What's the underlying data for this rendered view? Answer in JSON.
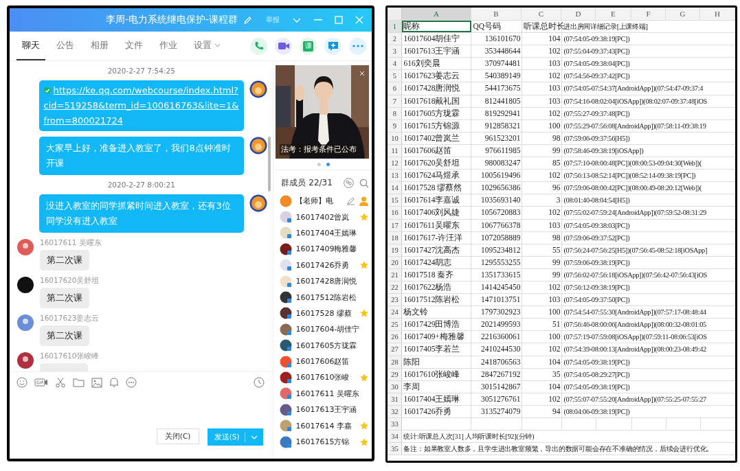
{
  "chat_window": {
    "title": "李周-电力系统继电保护-课程群",
    "report": "举报",
    "tabs": [
      {
        "label": "聊天",
        "selected": true,
        "kind": "plain"
      },
      {
        "label": "公告",
        "selected": false,
        "kind": "plain"
      },
      {
        "label": "相册",
        "selected": false,
        "kind": "plain"
      },
      {
        "label": "文件",
        "selected": false,
        "kind": "plain"
      },
      {
        "label": "作业",
        "selected": false,
        "kind": "plain"
      },
      {
        "label": "设置",
        "selected": false,
        "kind": "menu"
      }
    ],
    "actions": [
      {
        "kind": "call"
      },
      {
        "kind": "video"
      },
      {
        "kind": "course",
        "label": "课"
      },
      {
        "kind": "message"
      },
      {
        "kind": "more"
      }
    ],
    "messages": [
      {
        "kind": "time",
        "text": "2020-2-27 7:54:25"
      },
      {
        "kind": "link",
        "text": "https://ke.qq.com/webcourse/index.html?cid=519258&term_id=100616763&lite=1&from=800021724"
      },
      {
        "kind": "outgoing",
        "text": "大家早上好，准备进入教室了，我们8点钟准时开课"
      },
      {
        "kind": "time",
        "text": "2020-2-27 8:00:21"
      },
      {
        "kind": "outgoing",
        "text": "没进入教室的同学抓紧时间进入教室，还有3位同学没有进入教室"
      },
      {
        "kind": "incoming",
        "sender": "16017611 吴曜东",
        "text": "第二次课"
      },
      {
        "kind": "incoming",
        "sender": "16017620吴舒坦",
        "text": "第二次课"
      },
      {
        "kind": "incoming",
        "sender": "16017623姜志云",
        "text": "第二次课"
      },
      {
        "kind": "incoming",
        "sender": "16017610张峻峰"
      }
    ],
    "buttons": [
      {
        "label": "关闭(C)",
        "kind": "plain"
      },
      {
        "label": "发送(S)",
        "kind": "primary"
      }
    ],
    "ad": {
      "caption": "法考：报考条件已公布",
      "dots": [
        {
          "selected": false
        },
        {
          "selected": true
        }
      ]
    },
    "members_header": "群成员 22/31",
    "members": [
      {
        "name": "【老师】电",
        "kind": "teacher",
        "starred": false
      },
      {
        "name": "16017402曾岚",
        "kind": "student",
        "starred": true
      },
      {
        "name": "16017404王嫣琳",
        "kind": "student",
        "starred": false
      },
      {
        "name": "16017409梅雅馨",
        "kind": "student",
        "starred": false
      },
      {
        "name": "16017426乔勇",
        "kind": "student",
        "starred": true
      },
      {
        "name": "16017428唐润悦",
        "kind": "student",
        "starred": false
      },
      {
        "name": "16017512陈岩松",
        "kind": "student",
        "starred": false
      },
      {
        "name": "16017528 缪蔡",
        "kind": "student",
        "starred": true
      },
      {
        "name": "16017604-胡佳宁",
        "kind": "student",
        "starred": false
      },
      {
        "name": "16017605方珑霖",
        "kind": "student",
        "starred": false
      },
      {
        "name": "16017606赵笛",
        "kind": "student",
        "starred": false
      },
      {
        "name": "16017610张峻",
        "kind": "student",
        "starred": true
      },
      {
        "name": "16017611 吴曜东",
        "kind": "student",
        "starred": false
      },
      {
        "name": "16017613王宇涵",
        "kind": "student",
        "starred": false
      },
      {
        "name": "16017614 李嘉",
        "kind": "student",
        "starred": true
      },
      {
        "name": "16017615方锦",
        "kind": "student",
        "starred": true
      }
    ]
  },
  "spreadsheet": {
    "columns": [
      {
        "label": "A",
        "selected": true
      },
      {
        "label": "B",
        "selected": false
      },
      {
        "label": "C",
        "selected": false
      },
      {
        "label": "D",
        "selected": false
      },
      {
        "label": "E",
        "selected": false
      },
      {
        "label": "F",
        "selected": false
      },
      {
        "label": "G",
        "selected": false
      },
      {
        "label": "H",
        "selected": false
      }
    ],
    "rows": [
      {
        "number": "1",
        "kind": "header",
        "selected": true,
        "cells": [
          "昵称",
          "QQ号码",
          "听课总时长",
          "进出房间详细记录[上课终端]"
        ]
      },
      {
        "number": "2",
        "kind": "data",
        "selected": false,
        "cells": [
          "16017604胡佳宁",
          "136101670",
          "104",
          "(07:54:05-09:38:19[PC])"
        ]
      },
      {
        "number": "3",
        "kind": "data",
        "selected": false,
        "cells": [
          "16017613王宇涵",
          "353448644",
          "102",
          "(07:55:04-09:37:43[PC])"
        ]
      },
      {
        "number": "4",
        "kind": "data",
        "selected": false,
        "cells": [
          "616刘奕晨",
          "370974481",
          "103",
          "(07:54:05-09:38:04[PC])"
        ]
      },
      {
        "number": "5",
        "kind": "data",
        "selected": false,
        "cells": [
          "16017623姜志云",
          "540389149",
          "102",
          "(07:54:56-09:37:42[PC])"
        ]
      },
      {
        "number": "6",
        "kind": "data",
        "selected": false,
        "cells": [
          "16017428唐润悦",
          "544173675",
          "103",
          "(07:54:05-07:54:37[AndroidApp])(07:54:47-09:37:4"
        ]
      },
      {
        "number": "7",
        "kind": "data",
        "selected": false,
        "cells": [
          "16017618戴礼国",
          "812441805",
          "103",
          "(07:54:16-08:02:04[iOSApp])(08:02:07-09:37:48[iOS"
        ]
      },
      {
        "number": "8",
        "kind": "data",
        "selected": false,
        "cells": [
          "16017605方珑霖",
          "819292941",
          "102",
          "(07:55:27-09:37:48[PC])"
        ]
      },
      {
        "number": "9",
        "kind": "data",
        "selected": false,
        "cells": [
          "16017615方锦源",
          "912858321",
          "100",
          "(07:55:29-07:56:08[AndroidApp])(07:58:11-09:38:19"
        ]
      },
      {
        "number": "10",
        "kind": "data",
        "selected": false,
        "cells": [
          "16017402曾岚兰",
          "961523201",
          "98",
          "(07:59:06-09:37:56[H5])"
        ]
      },
      {
        "number": "11",
        "kind": "data",
        "selected": false,
        "cells": [
          "16017606赵笛",
          "976611985",
          "99",
          "(07:58:46-09:38:19[iOSApp])"
        ]
      },
      {
        "number": "12",
        "kind": "data",
        "selected": false,
        "cells": [
          "16017620吴舒坦",
          "980083247",
          "85",
          "(07:57:10-08:00:48[PC])(08:00:53-09:04:30[Web])("
        ]
      },
      {
        "number": "13",
        "kind": "data",
        "selected": false,
        "cells": [
          "16017624马煜承",
          "1005619496",
          "102",
          "(07:56:13-08:52:14[PC])(08:52:14-09:38:19[PC])"
        ]
      },
      {
        "number": "14",
        "kind": "data",
        "selected": false,
        "cells": [
          "16017528 缪蔡然",
          "1029656386",
          "96",
          "(07:59:06-08:00:42[PC])(08:00:49-08:20:12[Web])("
        ]
      },
      {
        "number": "15",
        "kind": "data",
        "selected": false,
        "cells": [
          "16017614李嘉诚",
          "1035693140",
          "3",
          "(08:01:40-08:04:54[H5])"
        ]
      },
      {
        "number": "16",
        "kind": "data",
        "selected": false,
        "cells": [
          "16017406刘风婕",
          "1056720883",
          "102",
          "(07:55:02-07:59:24[AndroidApp])(07:59:52-08:31:29"
        ]
      },
      {
        "number": "17",
        "kind": "data",
        "selected": false,
        "cells": [
          "16017611吴曜东",
          "1067766378",
          "103",
          "(07:54:05-09:38:03[PC])"
        ]
      },
      {
        "number": "18",
        "kind": "data",
        "selected": false,
        "cells": [
          "16017617-许汪洋",
          "1072058889",
          "98",
          "(07:59:06-09:37:52[PC])"
        ]
      },
      {
        "number": "19",
        "kind": "data",
        "selected": false,
        "cells": [
          "16017427沈高杰",
          "1095234812",
          "55",
          "(07:56:24-07:56:25[H5])(07:56:45-08:52:18[iOSApp]"
        ]
      },
      {
        "number": "20",
        "kind": "data",
        "selected": false,
        "cells": [
          "16017424胡志",
          "1295553255",
          "99",
          "(07:59:06-09:38:19[PC])"
        ]
      },
      {
        "number": "21",
        "kind": "data",
        "selected": false,
        "cells": [
          "16017518 秦齐",
          "1351733615",
          "99",
          "(07:56:02-07:56:18[iOSApp])(07:56:42-07:56:43[iOS"
        ]
      },
      {
        "number": "22",
        "kind": "data",
        "selected": false,
        "cells": [
          "16017622杨浩",
          "1414245450",
          "102",
          "(07:56:12-09:38:19[PC])"
        ]
      },
      {
        "number": "23",
        "kind": "data",
        "selected": false,
        "cells": [
          "16017512陈岩松",
          "1471013751",
          "103",
          "(07:54:05-09:37:50[PC])"
        ]
      },
      {
        "number": "24",
        "kind": "data",
        "selected": false,
        "cells": [
          "杨文铃",
          "1797302923",
          "100",
          "(07:54:54-07:55:30[AndroidApp])(07:57:17-08:48:44"
        ]
      },
      {
        "number": "25",
        "kind": "data",
        "selected": false,
        "cells": [
          "16017429田博浩",
          "2021499593",
          "51",
          "(07:56:46-08:00:06[AndroidApp])(08:00:32-08:01:05"
        ]
      },
      {
        "number": "26",
        "kind": "data",
        "selected": false,
        "cells": [
          "16017409+梅雅馨",
          "2216360061",
          "100",
          "(07:57:19-07:59:08[iOSApp])(07:59:11-08:06:53[iOS"
        ]
      },
      {
        "number": "27",
        "kind": "data",
        "selected": false,
        "cells": [
          "16017405李若兰",
          "2410244530",
          "102",
          "(07:54:39-08:00:13[AndroidApp])(08:00:23-08:49:42"
        ]
      },
      {
        "number": "28",
        "kind": "data",
        "selected": false,
        "cells": [
          "陈阳",
          "2418706563",
          "104",
          "(07:54:05-09:38:19[PC])"
        ]
      },
      {
        "number": "29",
        "kind": "data",
        "selected": false,
        "cells": [
          "16017610张峻峰",
          "2847267192",
          "35",
          "(07:54:05-08:29:27[PC])"
        ]
      },
      {
        "number": "30",
        "kind": "data",
        "selected": false,
        "cells": [
          "李周",
          "3015142867",
          "104",
          "(07:54:05-09:38:19[PC])"
        ]
      },
      {
        "number": "31",
        "kind": "data",
        "selected": false,
        "cells": [
          "16017404王嫣琳",
          "3051276761",
          "102",
          "(07:55:07-07:55:20[AndroidApp])(07:55:25-07:55:27"
        ]
      },
      {
        "number": "32",
        "kind": "data",
        "selected": false,
        "cells": [
          "16017426乔勇",
          "3135274079",
          "94",
          "(08:04:06-09:38:19[PC])"
        ]
      },
      {
        "number": "33",
        "kind": "blank",
        "selected": false
      },
      {
        "number": "34",
        "kind": "note",
        "selected": false,
        "cells": [
          "统计:听课总人次[31] 人均听课时长[92](分钟)"
        ]
      },
      {
        "number": "35",
        "kind": "note",
        "selected": false,
        "cells": [
          "备注：如果教室人数多，且学生进出教室频繁，导出的数据可能会存在不准确的情况，后续会进行优化。"
        ]
      }
    ]
  }
}
